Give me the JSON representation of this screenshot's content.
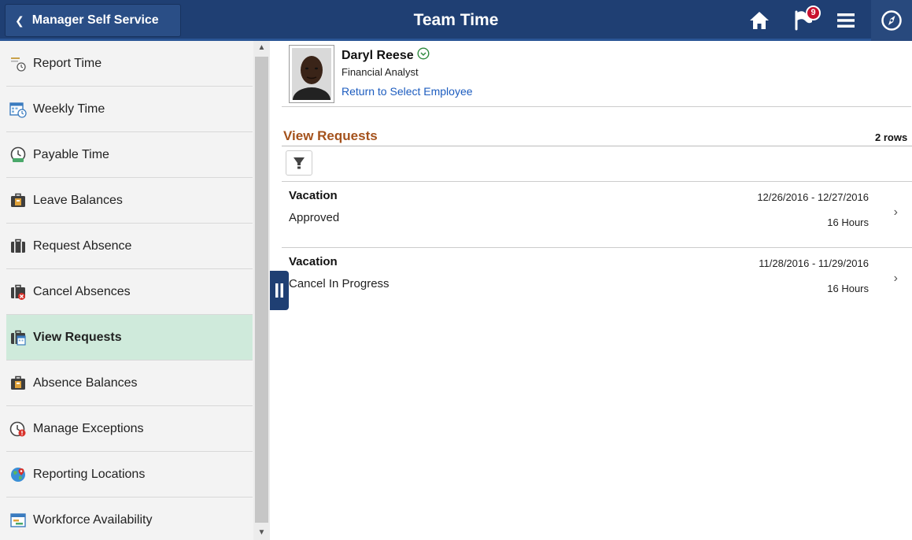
{
  "header": {
    "back_label": "Manager Self Service",
    "title": "Team Time",
    "notification_count": "9"
  },
  "sidebar": {
    "items": [
      {
        "label": "Report Time",
        "icon": "report-time-icon"
      },
      {
        "label": "Weekly Time",
        "icon": "weekly-time-icon"
      },
      {
        "label": "Payable Time",
        "icon": "payable-time-icon"
      },
      {
        "label": "Leave Balances",
        "icon": "leave-balances-icon"
      },
      {
        "label": "Request Absence",
        "icon": "request-absence-icon"
      },
      {
        "label": "Cancel Absences",
        "icon": "cancel-absences-icon"
      },
      {
        "label": "View Requests",
        "icon": "view-requests-icon"
      },
      {
        "label": "Absence Balances",
        "icon": "absence-balances-icon"
      },
      {
        "label": "Manage Exceptions",
        "icon": "manage-exceptions-icon"
      },
      {
        "label": "Reporting Locations",
        "icon": "reporting-locations-icon"
      },
      {
        "label": "Workforce Availability",
        "icon": "workforce-availability-icon"
      }
    ],
    "selected_index": 6
  },
  "employee": {
    "name": "Daryl Reese",
    "role": "Financial Analyst",
    "return_link": "Return to Select Employee"
  },
  "requests": {
    "title": "View Requests",
    "row_count": "2 rows",
    "rows": [
      {
        "type": "Vacation",
        "status": "Approved",
        "dates": "12/26/2016 - 12/27/2016",
        "hours": "16 Hours"
      },
      {
        "type": "Vacation",
        "status": "Cancel In Progress",
        "dates": "11/28/2016 - 11/29/2016",
        "hours": "16 Hours"
      }
    ]
  },
  "colors": {
    "header_bg": "#1f3f73",
    "selected_bg": "#cfeadb",
    "section_title": "#a4521c",
    "link": "#1c5cbf",
    "badge": "#c8102e"
  }
}
